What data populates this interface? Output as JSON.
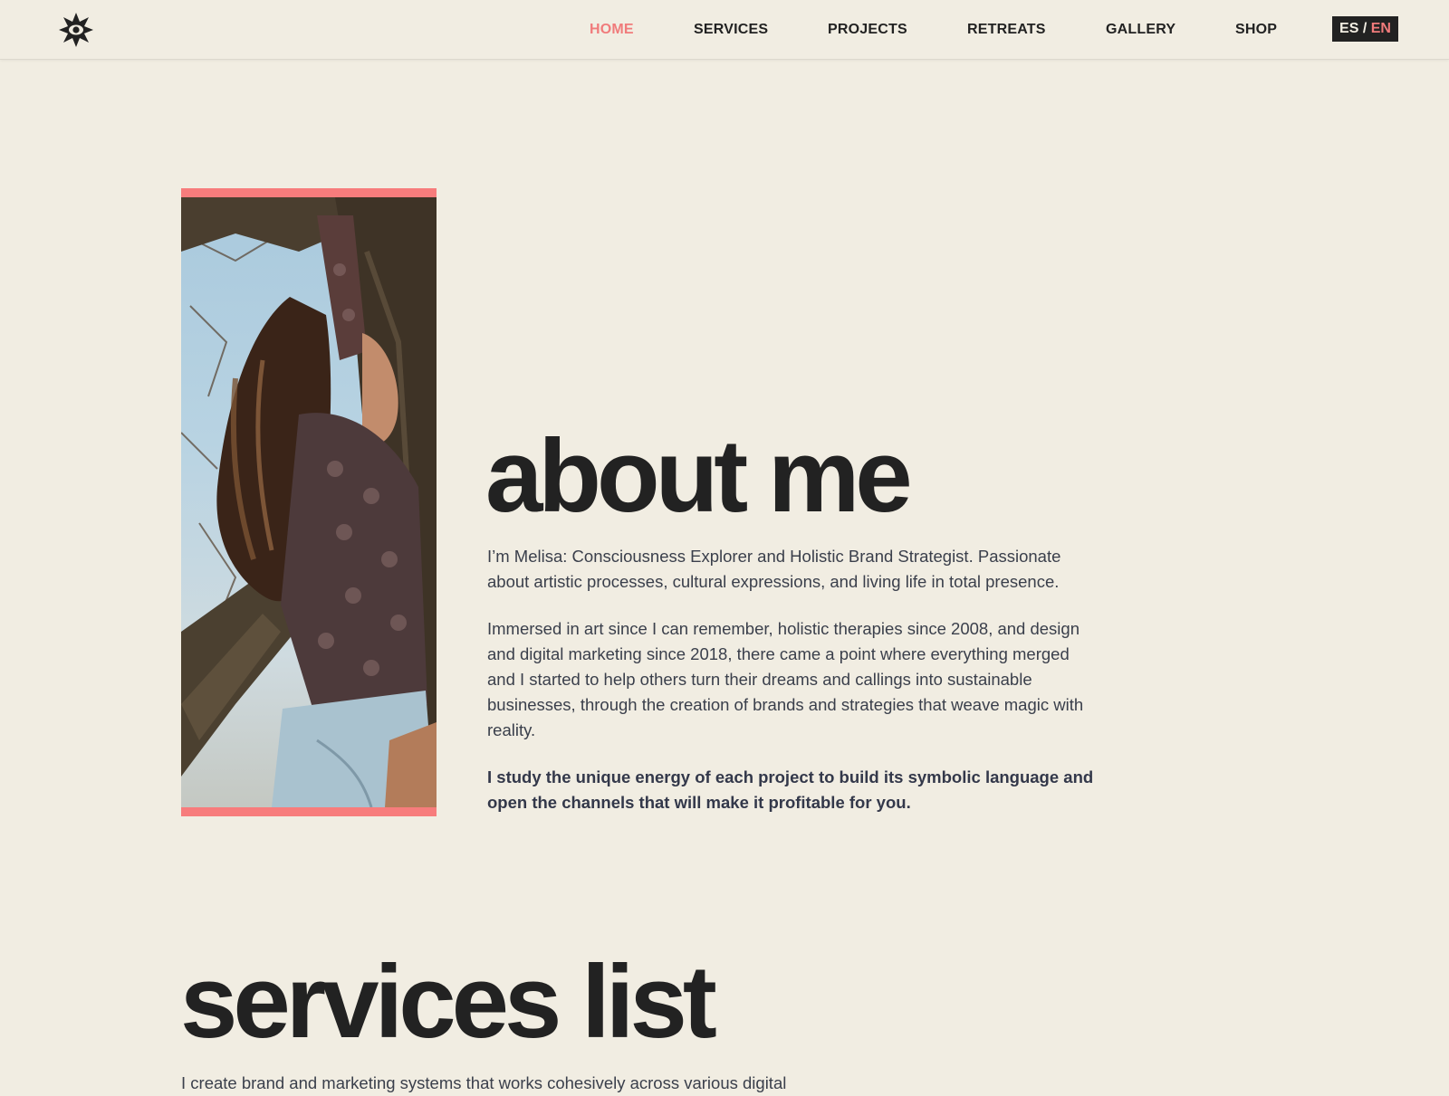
{
  "header": {
    "logo_icon": "sun-star-logo-icon",
    "nav": [
      {
        "label": "HOME",
        "active": true
      },
      {
        "label": "SERVICES",
        "active": false
      },
      {
        "label": "PROJECTS",
        "active": false
      },
      {
        "label": "RETREATS",
        "active": false
      },
      {
        "label": "GALLERY",
        "active": false
      },
      {
        "label": "SHOP",
        "active": false
      }
    ],
    "lang": {
      "es": "ES",
      "separator": " / ",
      "en": "EN",
      "active": "EN"
    }
  },
  "about": {
    "title": "about me",
    "p1": "I’m Melisa: Consciousness Explorer and Holistic Brand Strategist. Passionate about artistic processes, cultural expressions, and living life in total presence.",
    "p2": "Immersed in art since I can remember, holistic therapies since 2008, and design and digital marketing since 2018, there came a point where everything merged and I started to help others turn their dreams and callings into sustainable businesses, through the creation of brands and strategies that weave magic with reality.",
    "p3": "I study the unique energy of each project to build its symbolic language and open the channels that will make it profitable for you."
  },
  "services": {
    "title": "services list",
    "intro": "I create brand and marketing systems that works cohesively across various digital"
  },
  "colors": {
    "background": "#f1ede2",
    "accent": "#f07b7b",
    "text_dark": "#222222",
    "body_text": "#3a3f4b"
  }
}
